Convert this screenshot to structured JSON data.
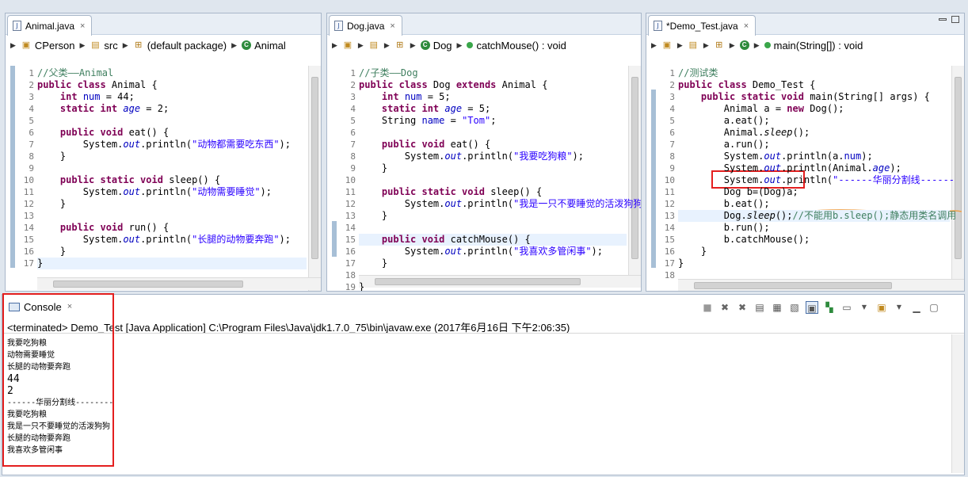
{
  "editors": [
    {
      "tab": "Animal.java",
      "bread": [
        "CPerson",
        "src",
        "(default package)",
        "Animal"
      ],
      "lines": [
        [
          {
            "t": "//父类——Animal",
            "c": "cmt"
          }
        ],
        [
          {
            "t": "public class ",
            "c": "kw"
          },
          {
            "t": "Animal {"
          }
        ],
        [
          {
            "t": "    "
          },
          {
            "t": "int ",
            "c": "kw"
          },
          {
            "t": "num",
            "c": "fld"
          },
          {
            "t": " = 44;"
          }
        ],
        [
          {
            "t": "    "
          },
          {
            "t": "static int ",
            "c": "kw"
          },
          {
            "t": "age",
            "c": "fld ital"
          },
          {
            "t": " = 2;"
          }
        ],
        [
          {
            "t": ""
          }
        ],
        [
          {
            "t": "    "
          },
          {
            "t": "public void ",
            "c": "kw"
          },
          {
            "t": "eat() {"
          }
        ],
        [
          {
            "t": "        System."
          },
          {
            "t": "out",
            "c": "fld ital"
          },
          {
            "t": ".println("
          },
          {
            "t": "\"动物都需要吃东西\"",
            "c": "str"
          },
          {
            "t": ");"
          }
        ],
        [
          {
            "t": "    }"
          }
        ],
        [
          {
            "t": ""
          }
        ],
        [
          {
            "t": "    "
          },
          {
            "t": "public static void ",
            "c": "kw"
          },
          {
            "t": "sleep() {"
          }
        ],
        [
          {
            "t": "        System."
          },
          {
            "t": "out",
            "c": "fld ital"
          },
          {
            "t": ".println("
          },
          {
            "t": "\"动物需要睡觉\"",
            "c": "str"
          },
          {
            "t": ");"
          }
        ],
        [
          {
            "t": "    }"
          }
        ],
        [
          {
            "t": ""
          }
        ],
        [
          {
            "t": "    "
          },
          {
            "t": "public void ",
            "c": "kw"
          },
          {
            "t": "run() {"
          }
        ],
        [
          {
            "t": "        System."
          },
          {
            "t": "out",
            "c": "fld ital"
          },
          {
            "t": ".println("
          },
          {
            "t": "\"长腿的动物要奔跑\"",
            "c": "str"
          },
          {
            "t": ");"
          }
        ],
        [
          {
            "t": "    }"
          }
        ],
        [
          {
            "t": "}"
          }
        ]
      ]
    },
    {
      "tab": "Dog.java",
      "bread": [
        "Dog",
        "catchMouse() : void"
      ],
      "lines": [
        [
          {
            "t": "//子类——Dog",
            "c": "cmt"
          }
        ],
        [
          {
            "t": "public class ",
            "c": "kw"
          },
          {
            "t": "Dog "
          },
          {
            "t": "extends ",
            "c": "kw"
          },
          {
            "t": "Animal {"
          }
        ],
        [
          {
            "t": "    "
          },
          {
            "t": "int ",
            "c": "kw"
          },
          {
            "t": "num",
            "c": "fld"
          },
          {
            "t": " = 5;"
          }
        ],
        [
          {
            "t": "    "
          },
          {
            "t": "static int ",
            "c": "kw"
          },
          {
            "t": "age",
            "c": "fld ital"
          },
          {
            "t": " = 5;"
          }
        ],
        [
          {
            "t": "    String "
          },
          {
            "t": "name",
            "c": "fld"
          },
          {
            "t": " = "
          },
          {
            "t": "\"Tom\"",
            "c": "str"
          },
          {
            "t": ";"
          }
        ],
        [
          {
            "t": ""
          }
        ],
        [
          {
            "t": "    "
          },
          {
            "t": "public void ",
            "c": "kw"
          },
          {
            "t": "eat() {"
          }
        ],
        [
          {
            "t": "        System."
          },
          {
            "t": "out",
            "c": "fld ital"
          },
          {
            "t": ".println("
          },
          {
            "t": "\"我要吃狗粮\"",
            "c": "str"
          },
          {
            "t": ");"
          }
        ],
        [
          {
            "t": "    }"
          }
        ],
        [
          {
            "t": ""
          }
        ],
        [
          {
            "t": "    "
          },
          {
            "t": "public static void ",
            "c": "kw"
          },
          {
            "t": "sleep() {"
          }
        ],
        [
          {
            "t": "        System."
          },
          {
            "t": "out",
            "c": "fld ital"
          },
          {
            "t": ".println("
          },
          {
            "t": "\"我是一只不要睡觉的活泼狗狗\"",
            "c": "str"
          },
          {
            "t": ")"
          }
        ],
        [
          {
            "t": "    }"
          }
        ],
        [
          {
            "t": ""
          }
        ],
        [
          {
            "t": "    "
          },
          {
            "t": "public void ",
            "c": "kw"
          },
          {
            "t": "catchMouse() {"
          }
        ],
        [
          {
            "t": "        System."
          },
          {
            "t": "out",
            "c": "fld ital"
          },
          {
            "t": ".println("
          },
          {
            "t": "\"我喜欢多管闲事\"",
            "c": "str"
          },
          {
            "t": ");"
          }
        ],
        [
          {
            "t": "    }"
          }
        ],
        [
          {
            "t": ""
          }
        ],
        [
          {
            "t": "}"
          }
        ]
      ]
    },
    {
      "tab": "*Demo_Test.java",
      "bread": [
        "main(String[]) : void"
      ],
      "lines": [
        [
          {
            "t": "//测试类",
            "c": "cmt"
          }
        ],
        [
          {
            "t": "public class ",
            "c": "kw"
          },
          {
            "t": "Demo_Test {"
          }
        ],
        [
          {
            "t": "    "
          },
          {
            "t": "public static void ",
            "c": "kw"
          },
          {
            "t": "main(String[] args) {"
          }
        ],
        [
          {
            "t": "        Animal a = "
          },
          {
            "t": "new ",
            "c": "kw"
          },
          {
            "t": "Dog();"
          }
        ],
        [
          {
            "t": "        a.eat();"
          }
        ],
        [
          {
            "t": "        Animal."
          },
          {
            "t": "sleep",
            "c": "ital"
          },
          {
            "t": "();"
          }
        ],
        [
          {
            "t": "        a.run();"
          }
        ],
        [
          {
            "t": "        System."
          },
          {
            "t": "out",
            "c": "fld ital"
          },
          {
            "t": ".println(a."
          },
          {
            "t": "num",
            "c": "fld"
          },
          {
            "t": ");"
          }
        ],
        [
          {
            "t": "        System."
          },
          {
            "t": "out",
            "c": "fld ital"
          },
          {
            "t": ".println(Animal."
          },
          {
            "t": "age",
            "c": "fld ital"
          },
          {
            "t": ");"
          }
        ],
        [
          {
            "t": "        System."
          },
          {
            "t": "out",
            "c": "fld ital"
          },
          {
            "t": ".println("
          },
          {
            "t": "\"------华丽分割线------",
            "c": "str"
          }
        ],
        [
          {
            "t": "        Dog b=(Dog)a;"
          }
        ],
        [
          {
            "t": "        b.eat();"
          }
        ],
        [
          {
            "t": "        Dog."
          },
          {
            "t": "sleep",
            "c": "ital"
          },
          {
            "t": "();"
          },
          {
            "t": "//不能用b.sleep();静态用类名调用",
            "c": "cmt"
          }
        ],
        [
          {
            "t": "        b.run();"
          }
        ],
        [
          {
            "t": "        b.catchMouse();"
          }
        ],
        [
          {
            "t": "    }"
          }
        ],
        [
          {
            "t": "}"
          }
        ],
        [
          {
            "t": ""
          }
        ]
      ]
    }
  ],
  "console": {
    "tab": "Console",
    "terminated": "<terminated> Demo_Test [Java Application] C:\\Program Files\\Java\\jdk1.7.0_75\\bin\\javaw.exe (2017年6月16日 下午2:06:35)",
    "output": [
      "我要吃狗粮",
      "动物需要睡觉",
      "长腿的动物要奔跑",
      "44",
      "2",
      "------华丽分割线--------",
      "我要吃狗粮",
      "我是一只不要睡觉的活泼狗狗",
      "长腿的动物要奔跑",
      "我喜欢多管闲事"
    ]
  },
  "icons": {
    "close": "×",
    "collapse": "▸",
    "java": "J"
  }
}
